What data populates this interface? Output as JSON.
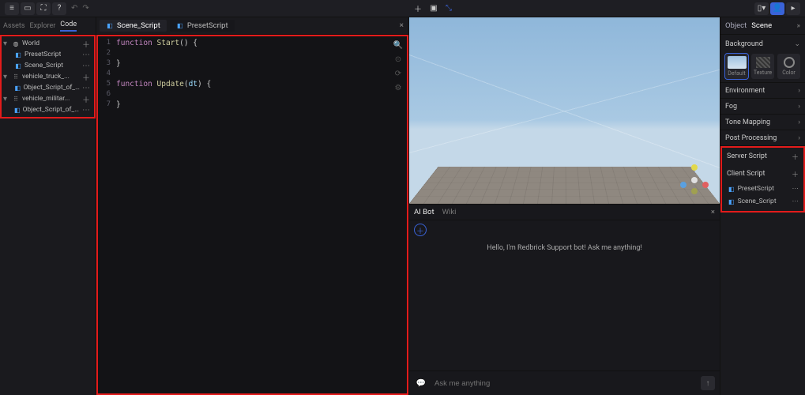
{
  "colors": {
    "accent": "#3a63d8",
    "highlight": "#e31b1b"
  },
  "leftTabs": {
    "t0": "Assets",
    "t1": "Explorer",
    "t2": "Code"
  },
  "tree": {
    "world": "World",
    "preset": "PresetScript",
    "scene": "Scene_Script",
    "truck": "vehicle_truck_...",
    "truckScript": "Object_Script_of_truck",
    "militar": "vehicle_militar...",
    "planeScript": "Object_Script_of_AirPlane"
  },
  "editorTabs": {
    "t0": "Scene_Script",
    "t1": "PresetScript"
  },
  "code": {
    "l1": "1",
    "l2": "2",
    "l3": "3",
    "l4": "4",
    "l5": "5",
    "l6": "6",
    "l7": "7",
    "line1_kw": "function",
    "line1_fn": "Start",
    "line1_rest": "() {",
    "line3": "}",
    "line5_kw": "function",
    "line5_fn": "Update",
    "line5_param": "dt",
    "line5_open": "(",
    "line5_close": ") {",
    "line7": "}"
  },
  "chat": {
    "tab0": "AI Bot",
    "tab1": "Wiki",
    "greeting": "Hello, I'm Redbrick Support bot! Ask me anything!",
    "placeholder": "Ask me anything"
  },
  "inspector": {
    "breadcrumb0": "Object",
    "breadcrumb1": "Scene",
    "background": "Background",
    "bgDefault": "Default",
    "bgTexture": "Texture",
    "bgColor": "Color",
    "env": "Environment",
    "fog": "Fog",
    "tone": "Tone Mapping",
    "post": "Post Processing",
    "serverScript": "Server Script",
    "clientScript": "Client Script",
    "clientItem0": "PresetScript",
    "clientItem1": "Scene_Script"
  },
  "chart_data": null
}
